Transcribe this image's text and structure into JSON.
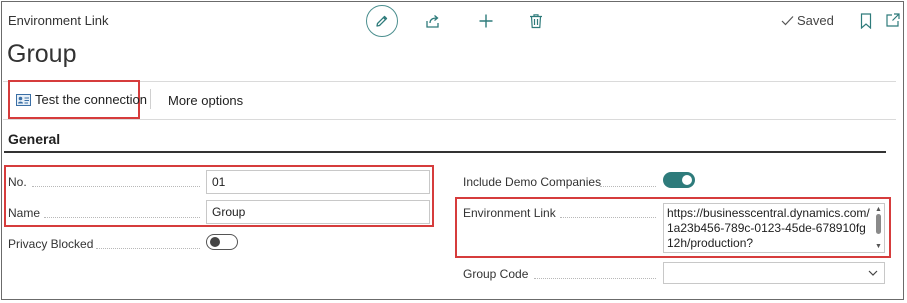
{
  "header": {
    "breadcrumb": "Environment Link",
    "title": "Group",
    "saved_label": "Saved"
  },
  "toolbar": {
    "icons": [
      "pencil-icon",
      "share-icon",
      "plus-icon",
      "trash-icon",
      "bookmark-icon",
      "open-in-new-icon"
    ],
    "accent_color": "#2e7b7b"
  },
  "actions": {
    "test_connection": "Test the connection",
    "more_options": "More options"
  },
  "section": {
    "title": "General"
  },
  "fields": {
    "no": {
      "label": "No.",
      "value": "01"
    },
    "name": {
      "label": "Name",
      "value": "Group"
    },
    "privacy_blocked": {
      "label": "Privacy Blocked",
      "value": false
    },
    "include_demo_companies": {
      "label": "Include Demo Companies",
      "value": true
    },
    "environment_link": {
      "label": "Environment Link",
      "value": "https://businesscentral.dynamics.com/1a23b456-789c-0123-45de-678910fg12h/production?"
    },
    "group_code": {
      "label": "Group Code",
      "value": ""
    }
  },
  "highlight_color": "#d63c3c"
}
